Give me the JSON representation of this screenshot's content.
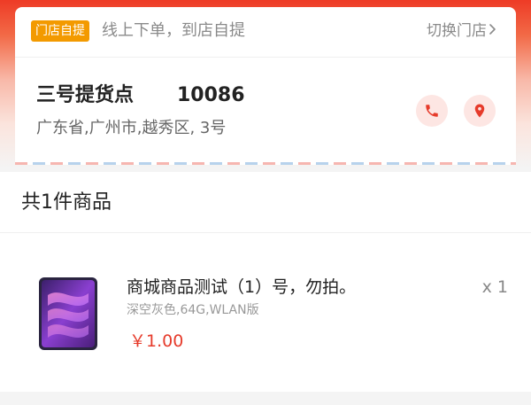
{
  "pickup": {
    "badge": "门店自提",
    "description": "线上下单，到店自提",
    "switch_label": "切换门店",
    "switch_icon": "chevron-right-icon"
  },
  "store": {
    "name": "三号提货点",
    "phone": "10086",
    "address": "广东省,广州市,越秀区, 3号",
    "call_icon": "phone-icon",
    "location_icon": "location-pin-icon"
  },
  "goods": {
    "count_label": "共1件商品",
    "items": [
      {
        "name": "商城商品测试（1）号，勿拍。",
        "spec": "深空灰色,64G,WLAN版",
        "price": "￥1.00",
        "quantity": "x 1",
        "image_icon": "tablet-product-image"
      }
    ]
  },
  "colors": {
    "accent_red": "#e63b2b",
    "badge_orange": "#f39a00",
    "icon_bg": "#fde6e3"
  }
}
